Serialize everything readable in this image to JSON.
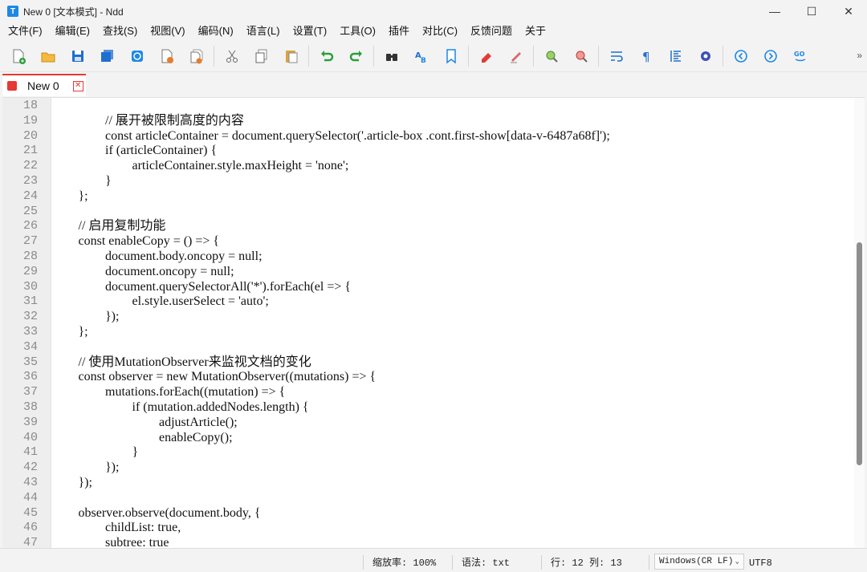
{
  "window": {
    "title": "New 0 [文本模式] - Ndd",
    "app_icon_letter": "T",
    "minimize_glyph": "—",
    "maximize_glyph": "☐",
    "close_glyph": "✕"
  },
  "menu": [
    "文件(F)",
    "编辑(E)",
    "查找(S)",
    "视图(V)",
    "编码(N)",
    "语言(L)",
    "设置(T)",
    "工具(O)",
    "插件",
    "对比(C)",
    "反馈问题",
    "关于"
  ],
  "toolbar": {
    "buttons": [
      "new-file-icon",
      "open-folder-icon",
      "save-icon",
      "save-all-icon",
      "reload-icon",
      "close-file-icon",
      "close-all-icon",
      "cut-icon",
      "copy-icon",
      "paste-icon",
      "undo-icon",
      "redo-icon",
      "find-icon",
      "replace-icon",
      "bookmark-icon",
      "mark-icon",
      "clear-mark-icon",
      "zoom-in-icon",
      "zoom-out-icon",
      "word-wrap-icon",
      "show-symbols-icon",
      "indent-guide-icon",
      "settings-icon",
      "nav-back-icon",
      "nav-forward-icon",
      "goto-line-icon"
    ],
    "more_glyph": "»",
    "colors": {
      "save": "#1e6fd0",
      "undo": "#2e9d3c",
      "mark": "#e53935",
      "nav": "#1e88e5"
    }
  },
  "tab": {
    "label": "New 0",
    "close_glyph": "✕",
    "accent": "#e53935"
  },
  "editor": {
    "lines": [
      {
        "n": "18",
        "indent": 0,
        "text": ""
      },
      {
        "n": "19",
        "indent": 2,
        "text": "// 展开被限制高度的内容"
      },
      {
        "n": "20",
        "indent": 2,
        "text": "const articleContainer = document.querySelector('.article-box .cont.first-show[data-v-6487a68f]');"
      },
      {
        "n": "21",
        "indent": 2,
        "text": "if (articleContainer) {"
      },
      {
        "n": "22",
        "indent": 3,
        "text": "articleContainer.style.maxHeight = 'none';"
      },
      {
        "n": "23",
        "indent": 2,
        "text": "}"
      },
      {
        "n": "24",
        "indent": 1,
        "text": "};"
      },
      {
        "n": "25",
        "indent": 0,
        "text": ""
      },
      {
        "n": "26",
        "indent": 1,
        "text": "// 启用复制功能"
      },
      {
        "n": "27",
        "indent": 1,
        "text": "const enableCopy = () => {"
      },
      {
        "n": "28",
        "indent": 2,
        "text": "document.body.oncopy = null;"
      },
      {
        "n": "29",
        "indent": 2,
        "text": "document.oncopy = null;"
      },
      {
        "n": "30",
        "indent": 2,
        "text": "document.querySelectorAll('*').forEach(el => {"
      },
      {
        "n": "31",
        "indent": 3,
        "text": "el.style.userSelect = 'auto';"
      },
      {
        "n": "32",
        "indent": 2,
        "text": "});"
      },
      {
        "n": "33",
        "indent": 1,
        "text": "};"
      },
      {
        "n": "34",
        "indent": 0,
        "text": ""
      },
      {
        "n": "35",
        "indent": 1,
        "text": "// 使用MutationObserver来监视文档的变化"
      },
      {
        "n": "36",
        "indent": 1,
        "text": "const observer = new MutationObserver((mutations) => {"
      },
      {
        "n": "37",
        "indent": 2,
        "text": "mutations.forEach((mutation) => {"
      },
      {
        "n": "38",
        "indent": 3,
        "text": "if (mutation.addedNodes.length) {"
      },
      {
        "n": "39",
        "indent": 4,
        "text": "adjustArticle();"
      },
      {
        "n": "40",
        "indent": 4,
        "text": "enableCopy();"
      },
      {
        "n": "41",
        "indent": 3,
        "text": "}"
      },
      {
        "n": "42",
        "indent": 2,
        "text": "});"
      },
      {
        "n": "43",
        "indent": 1,
        "text": "});"
      },
      {
        "n": "44",
        "indent": 0,
        "text": ""
      },
      {
        "n": "45",
        "indent": 1,
        "text": "observer.observe(document.body, {"
      },
      {
        "n": "46",
        "indent": 2,
        "text": "childList: true,"
      },
      {
        "n": "47",
        "indent": 2,
        "text": "subtree: true"
      }
    ]
  },
  "status": {
    "zoom": "缩放率: 100%",
    "syntax": "语法: txt",
    "position": "行: 12 列: 13",
    "line_ending": "Windows(CR LF)",
    "encoding": "UTF8",
    "chevron": "⌄"
  }
}
